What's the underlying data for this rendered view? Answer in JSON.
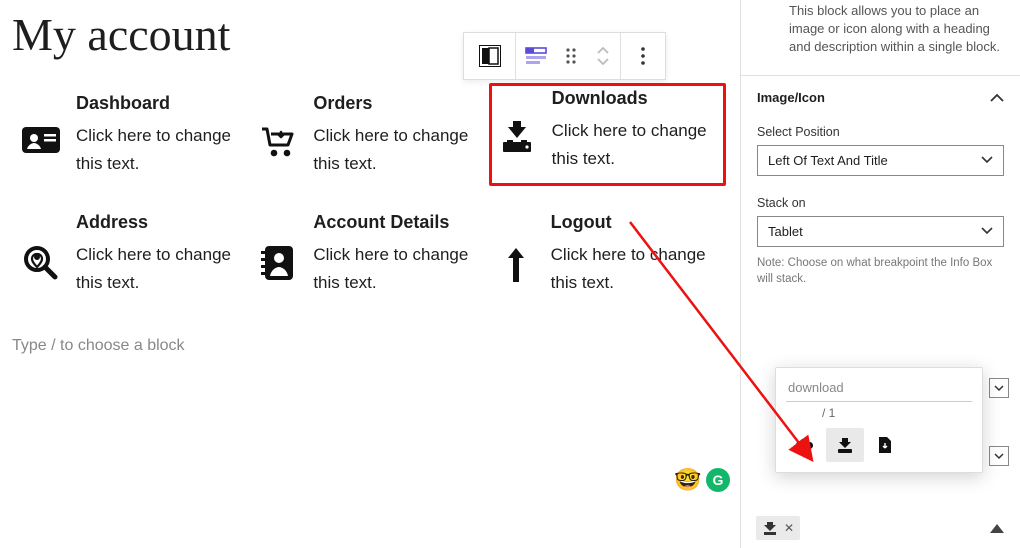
{
  "page": {
    "title": "My account"
  },
  "items": [
    {
      "title": "Dashboard",
      "desc": "Click here to change this text.",
      "icon": "id-card"
    },
    {
      "title": "Orders",
      "desc": "Click here to change this text.",
      "icon": "cart"
    },
    {
      "title": "Downloads",
      "desc": "Click here to change this text.",
      "icon": "download",
      "selected": true
    },
    {
      "title": "Address",
      "desc": "Click here to change this text.",
      "icon": "magnify"
    },
    {
      "title": "Account Details",
      "desc": "Click here to change this text.",
      "icon": "contacts"
    },
    {
      "title": "Logout",
      "desc": "Click here to change this text.",
      "icon": "arrow-up"
    }
  ],
  "editor": {
    "placeholder": "Type / to choose a block"
  },
  "sidebar": {
    "block_desc": "This block allows you to place an image or icon along with a heading and description within a single block.",
    "section_title": "Image/Icon",
    "position_label": "Select Position",
    "position_value": "Left Of Text And Title",
    "stack_label": "Stack on",
    "stack_value": "Tablet",
    "note": "Note: Choose on what breakpoint the Info Box will stack."
  },
  "popover": {
    "search": "download",
    "pager": "/  1",
    "icons": [
      "cloud-download",
      "download",
      "file-download"
    ],
    "selected_index": 1
  }
}
